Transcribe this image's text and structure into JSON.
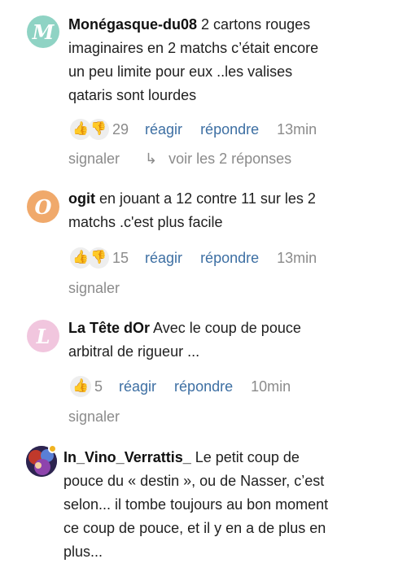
{
  "comments": [
    {
      "author": "Monégasque-du08",
      "avatar_letter": "M",
      "avatar_color": "#8fd3c4",
      "text_lines": [
        "2 cartons rouges",
        "imaginaires en 2 matchs c’était encore",
        "un peu limite pour eux ..les valises",
        "qataris sont lourdes"
      ],
      "reactions": [
        "thumbs-up",
        "thumbs-down"
      ],
      "count": "29",
      "react_label": "réagir",
      "reply_label": "répondre",
      "time": "13min",
      "report_label": "signaler",
      "replies_label": "voir les 2 réponses"
    },
    {
      "author": "ogit",
      "avatar_letter": "O",
      "avatar_color": "#f0a96b",
      "text_lines": [
        "en jouant a 12 contre 11 sur les 2",
        "matchs .c'est plus facile"
      ],
      "reactions": [
        "thumbs-up",
        "thumbs-down"
      ],
      "count": "15",
      "react_label": "réagir",
      "reply_label": "répondre",
      "time": "13min",
      "report_label": "signaler"
    },
    {
      "author": "La Tête dOr",
      "avatar_letter": "L",
      "avatar_color": "#f1c6de",
      "text_lines": [
        "Avec le coup de pouce",
        "arbitral de rigueur ..."
      ],
      "reactions": [
        "thumbs-up"
      ],
      "count": "5",
      "react_label": "réagir",
      "reply_label": "répondre",
      "time": "10min",
      "report_label": "signaler"
    },
    {
      "author": "In_Vino_Verrattis_",
      "text_lines": [
        "Le petit coup de",
        "pouce du « destin », ou de Nasser, c’est",
        "selon... il tombe toujours au bon moment",
        "ce coup de pouce, et il y en a de plus en",
        "plus..."
      ]
    }
  ],
  "icons": {
    "thumbs_up": "👍",
    "thumbs_down": "👎",
    "reply_arrow": "↳"
  }
}
